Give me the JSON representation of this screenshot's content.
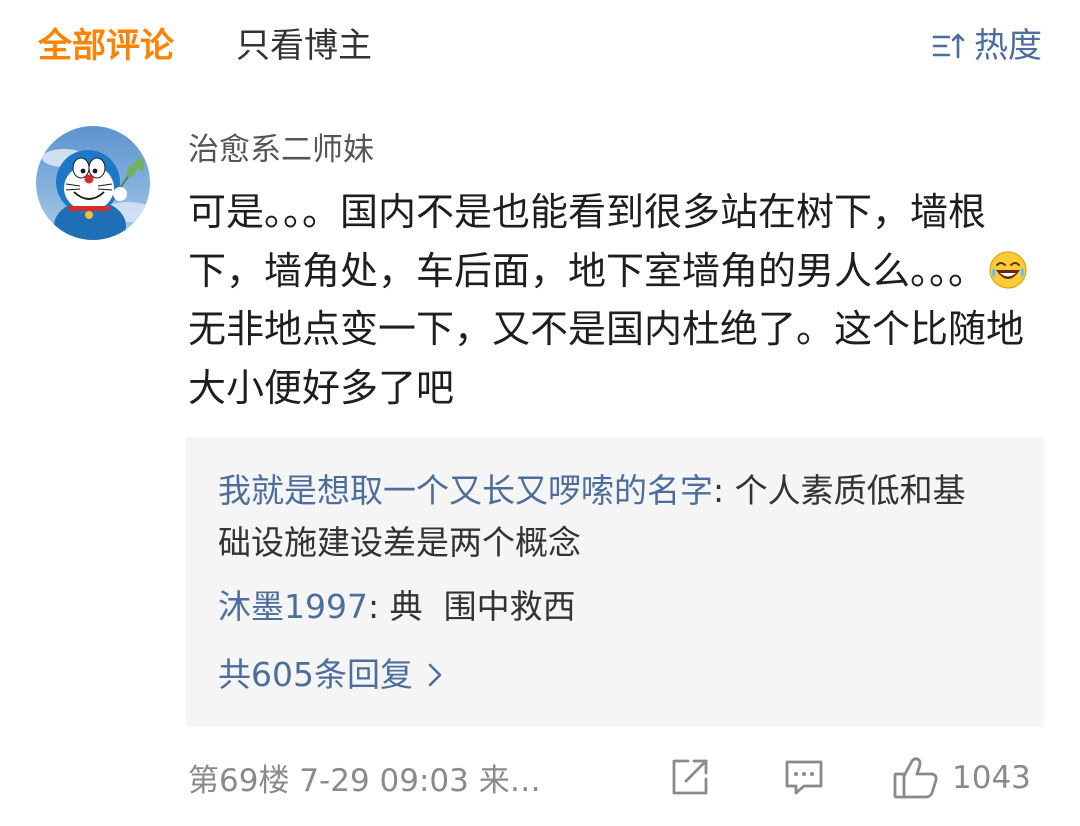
{
  "tabs": {
    "all": "全部评论",
    "blogger_only": "只看博主"
  },
  "sort": {
    "label": "热度",
    "icon": "sort-icon"
  },
  "comment": {
    "username": "治愈系二师妹",
    "text_before_emoji": "可是。。。国内不是也能看到很多站在树下，墙根下，墙角处，车后面，地下室墙角的男人么。。。",
    "emoji": "laughing-crying-emoji",
    "text_after_emoji": "无非地点变一下，又不是国内杜绝了。这个比随地大小便好多了吧",
    "floor": "第69楼",
    "time": "7-29 09:03",
    "source": "来…",
    "like_count": "1043"
  },
  "replies": [
    {
      "name": "我就是想取一个又长又啰嗦的名字",
      "sep": ": ",
      "text": "个人素质低和基础设施建设差是两个概念"
    },
    {
      "name": "沐墨1997",
      "sep": ": ",
      "text": "典  围中救西"
    }
  ],
  "more_replies": "共605条回复",
  "colors": {
    "accent": "#ff8200",
    "link": "#4d6d9b",
    "reply_bg": "#f5f5f5"
  }
}
